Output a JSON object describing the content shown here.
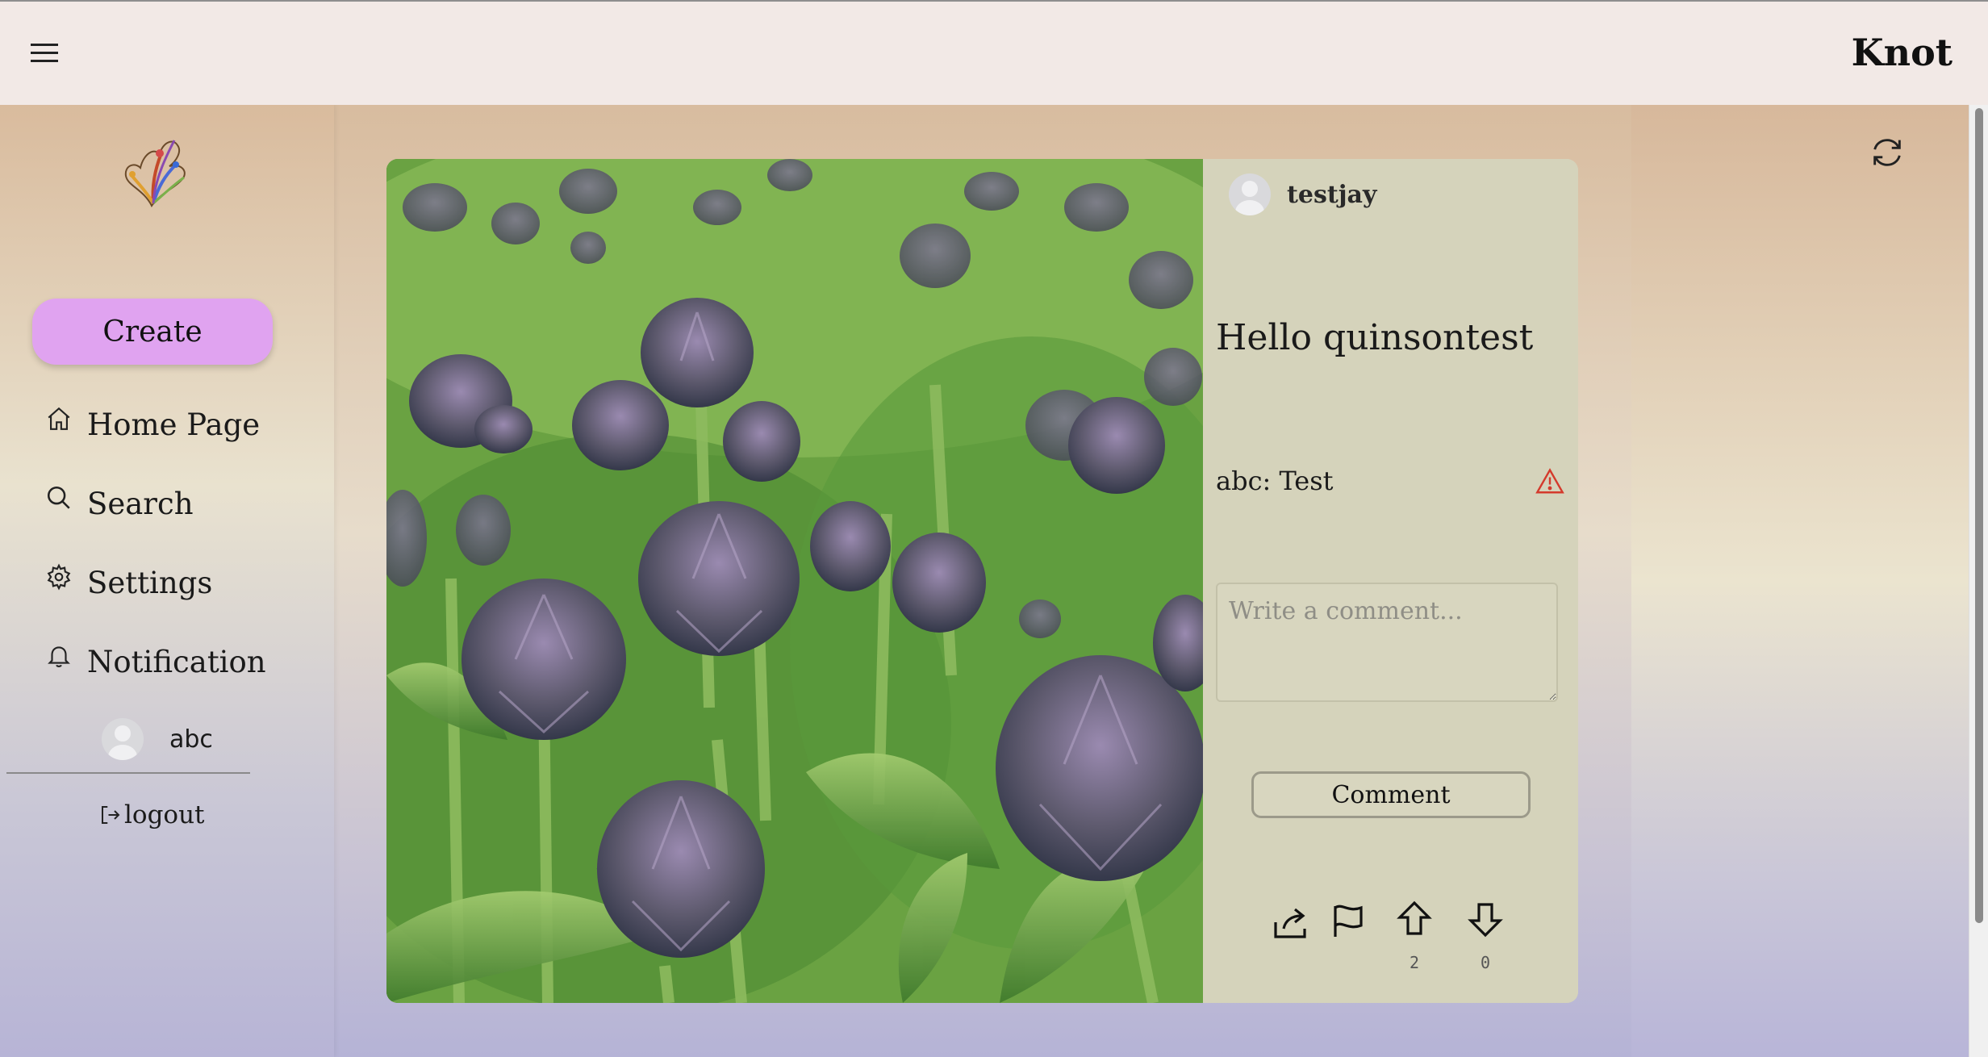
{
  "header": {
    "brand": "Knot"
  },
  "sidebar": {
    "create_label": "Create",
    "nav": [
      {
        "label": "Home Page",
        "icon": "home-icon"
      },
      {
        "label": "Search",
        "icon": "search-icon"
      },
      {
        "label": "Settings",
        "icon": "gear-icon"
      },
      {
        "label": "Notification",
        "icon": "bell-icon"
      }
    ],
    "user": {
      "name": "abc"
    },
    "logout_label": "logout"
  },
  "post": {
    "author": "testjay",
    "title": "Hello quinsontest",
    "comments": [
      {
        "text": "abc: Test",
        "flag_icon": "warning-icon",
        "flag_color": "#d43a2c"
      }
    ],
    "comment_placeholder": "Write a comment...",
    "comment_button": "Comment",
    "upvotes": "2",
    "downvotes": "0",
    "image_subject": "artichoke flowers"
  },
  "colors": {
    "create_button": "#e0a3f0",
    "panel_bg": "#d5d3bb",
    "topbar_bg": "#f2e9e6"
  }
}
